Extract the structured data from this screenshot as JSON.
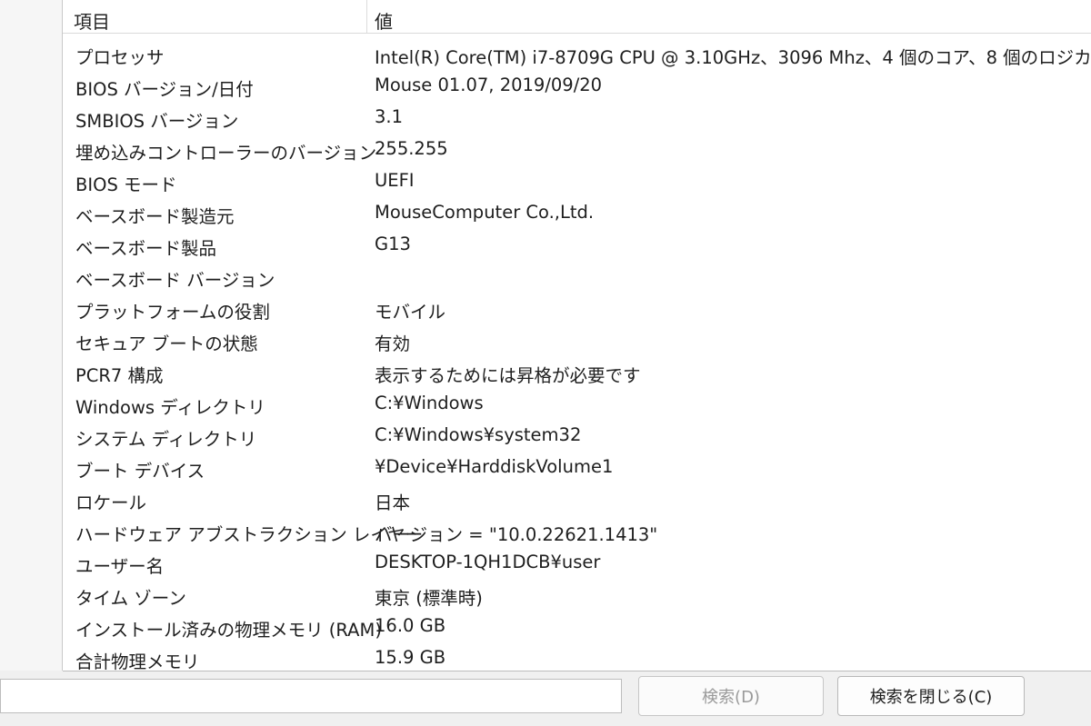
{
  "header": {
    "item_col": "項目",
    "value_col": "値"
  },
  "rows": [
    {
      "item": "プロセッサ",
      "value": "Intel(R) Core(TM) i7-8709G CPU @ 3.10GHz、3096 Mhz、4 個のコア、8 個のロジカ..."
    },
    {
      "item": "BIOS バージョン/日付",
      "value": "Mouse 01.07, 2019/09/20"
    },
    {
      "item": "SMBIOS バージョン",
      "value": "3.1"
    },
    {
      "item": "埋め込みコントローラーのバージョン",
      "value": "255.255"
    },
    {
      "item": "BIOS モード",
      "value": "UEFI"
    },
    {
      "item": "ベースボード製造元",
      "value": "MouseComputer Co.,Ltd."
    },
    {
      "item": "ベースボード製品",
      "value": "G13"
    },
    {
      "item": "ベースボード バージョン",
      "value": ""
    },
    {
      "item": "プラットフォームの役割",
      "value": "モバイル"
    },
    {
      "item": "セキュア ブートの状態",
      "value": "有効"
    },
    {
      "item": "PCR7 構成",
      "value": "表示するためには昇格が必要です"
    },
    {
      "item": "Windows ディレクトリ",
      "value": "C:¥Windows"
    },
    {
      "item": "システム ディレクトリ",
      "value": "C:¥Windows¥system32"
    },
    {
      "item": "ブート デバイス",
      "value": "¥Device¥HarddiskVolume1"
    },
    {
      "item": "ロケール",
      "value": "日本"
    },
    {
      "item": "ハードウェア アブストラクション レイヤー",
      "value": "バージョン = \"10.0.22621.1413\""
    },
    {
      "item": "ユーザー名",
      "value": "DESKTOP-1QH1DCB¥user"
    },
    {
      "item": "タイム ゾーン",
      "value": "東京 (標準時)"
    },
    {
      "item": "インストール済みの物理メモリ (RAM)",
      "value": "16.0 GB"
    },
    {
      "item": "合計物理メモリ",
      "value": "15.9 GB"
    }
  ],
  "search": {
    "value": ""
  },
  "buttons": {
    "search": "検索(D)",
    "close_search": "検索を閉じる(C)"
  }
}
